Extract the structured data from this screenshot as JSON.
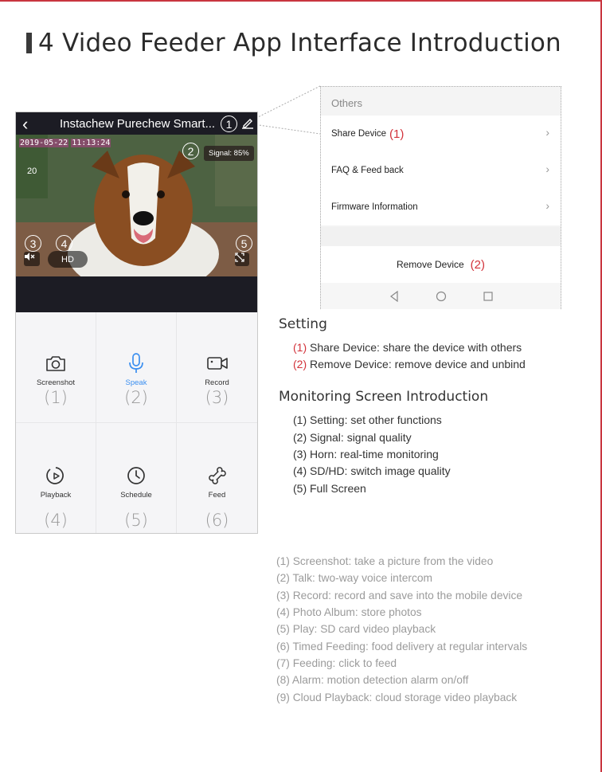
{
  "title": "4 Video Feeder App Interface Introduction",
  "phone": {
    "device_name": "Instachew Purechew Smart...",
    "timestamp_date": "2019-05-22",
    "timestamp_time": "11:13:24",
    "overlay_number": "20",
    "signal": "Signal: 85%",
    "hd_label": "HD",
    "markers": [
      "1",
      "2",
      "3",
      "4",
      "5"
    ],
    "buttons": [
      {
        "label": "Screenshot",
        "index": "(1)"
      },
      {
        "label": "Speak",
        "index": "(2)"
      },
      {
        "label": "Record",
        "index": "(3)"
      },
      {
        "label": "Playback",
        "index": "(4)"
      },
      {
        "label": "Schedule",
        "index": "(5)"
      },
      {
        "label": "Feed",
        "index": "(6)"
      }
    ]
  },
  "others": {
    "header": "Others",
    "share": "Share Device",
    "share_num": "(1)",
    "faq": "FAQ & Feed back",
    "firmware": "Firmware Information",
    "remove": "Remove Device",
    "remove_num": "(2)"
  },
  "setting": {
    "heading": "Setting",
    "items": [
      {
        "num": "(1)",
        "text": " Share Device: share the device with others"
      },
      {
        "num": "(2)",
        "text": " Remove Device: remove device and unbind"
      }
    ]
  },
  "monitoring": {
    "heading": "Monitoring Screen Introduction",
    "items": [
      "(1) Setting: set other functions",
      "(2) Signal: signal quality",
      "(3) Horn: real-time monitoring",
      "(4) SD/HD: switch image quality",
      "(5) Full Screen"
    ]
  },
  "functions": [
    "(1) Screenshot: take a picture from the video",
    "(2) Talk: two-way voice intercom",
    "(3) Record: record and save into the mobile device",
    "(4) Photo Album: store photos",
    "(5) Play: SD card video playback",
    "(6) Timed Feeding: food delivery at regular intervals",
    "(7) Feeding: click to feed",
    "(8) Alarm: motion detection alarm on/off",
    "(9) Cloud Playback: cloud storage video playback"
  ]
}
